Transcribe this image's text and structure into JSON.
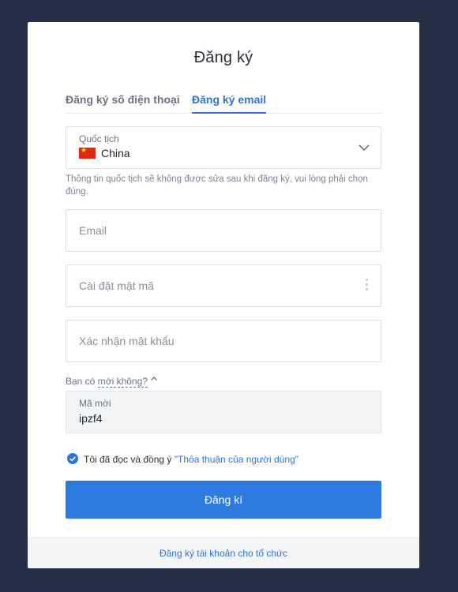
{
  "title": "Đăng ký",
  "tabs": {
    "phone": "Đăng ký số điện thoại",
    "email": "Đăng ký email"
  },
  "nationality": {
    "label": "Quốc tịch",
    "value": "China",
    "hint": "Thông tin quốc tịch sẽ không được sửa sau khi đăng ký, vui lòng phải chọn đúng."
  },
  "email_field": {
    "placeholder": "Email"
  },
  "password_field": {
    "placeholder": "Cài đặt mật mã"
  },
  "confirm_field": {
    "placeholder": "Xác nhận mật khẩu"
  },
  "invite": {
    "question_prefix": "Bạn có ",
    "question_link": "mời không?",
    "code_label": "Mã mời",
    "code_value": "ipzf4"
  },
  "agreement": {
    "text": "Tôi đã đọc và đồng ý ",
    "link": "\"Thỏa thuận của người dùng\"",
    "checked": true
  },
  "submit_label": "Đăng kí",
  "footer_link": "Đăng ký tài khoản cho tổ chức",
  "colors": {
    "accent": "#2e7be0",
    "background": "#252e45"
  }
}
